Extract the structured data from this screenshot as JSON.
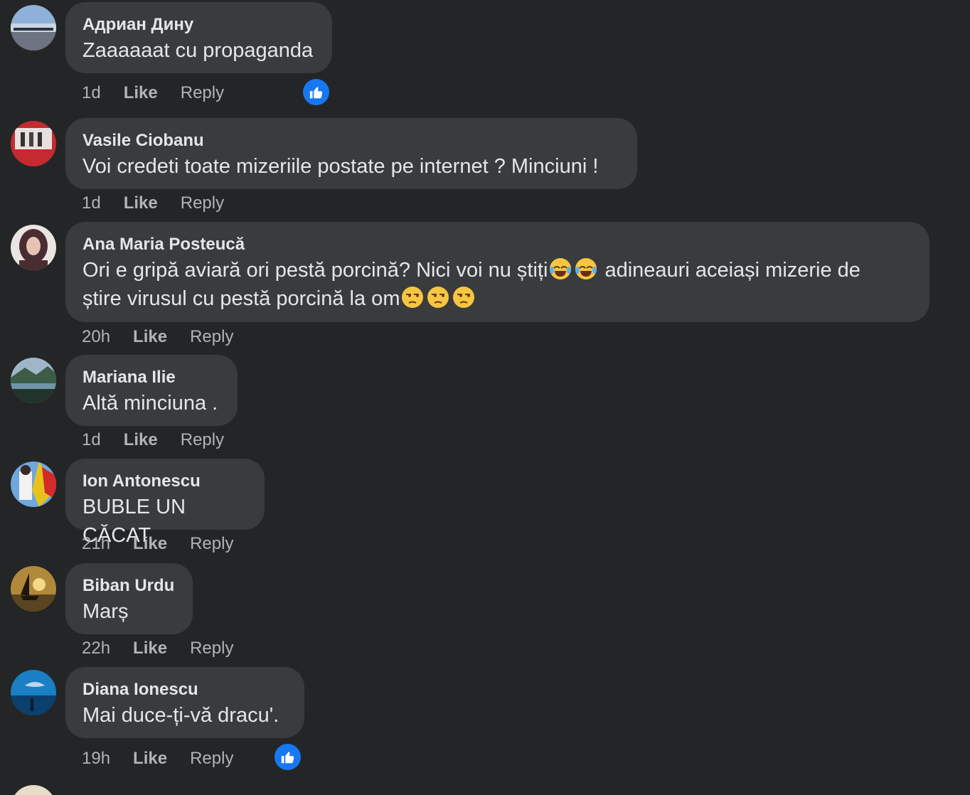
{
  "comments": [
    {
      "author": "Адриан Дину",
      "text": "Zaaaaaat cu propaganda",
      "time": "1d",
      "like_label": "Like",
      "reply_label": "Reply",
      "has_reaction": true
    },
    {
      "author": "Vasile Ciobanu",
      "text": "Voi credeti toate mizeriile postate pe internet ? Minciuni !",
      "time": "1d",
      "like_label": "Like",
      "reply_label": "Reply"
    },
    {
      "author": "Ana Maria Posteucă",
      "text_line1_a": "Ori e gripă aviară ori pestă porcină? Nici voi nu știți",
      "text_line1_b": " adineauri aceiași mizerie de",
      "text_line2": "știre virusul cu pestă porcină la om",
      "time": "20h",
      "like_label": "Like",
      "reply_label": "Reply"
    },
    {
      "author": "Mariana Ilie",
      "text": "Altă minciuna .",
      "time": "1d",
      "like_label": "Like",
      "reply_label": "Reply"
    },
    {
      "author": "Ion Antonescu",
      "text": "BUBLE UN CĂCAT",
      "time": "21h",
      "like_label": "Like",
      "reply_label": "Reply"
    },
    {
      "author": "Biban Urdu",
      "text": "Marș",
      "time": "22h",
      "like_label": "Like",
      "reply_label": "Reply"
    },
    {
      "author": "Diana Ionescu",
      "text": "Mai duce-ți-vă dracu'.",
      "time": "19h",
      "like_label": "Like",
      "reply_label": "Reply",
      "has_reaction": true
    }
  ],
  "colors": {
    "background": "#242526",
    "bubble": "#3a3b3c",
    "primary_text": "#e4e6eb",
    "secondary_text": "#b0b3b8",
    "like_reaction": "#1877f2"
  },
  "icons": {
    "reaction": "thumbs-up-icon",
    "emoji_laugh": "tears-of-joy-emoji",
    "emoji_unamused": "unamused-face-emoji"
  }
}
